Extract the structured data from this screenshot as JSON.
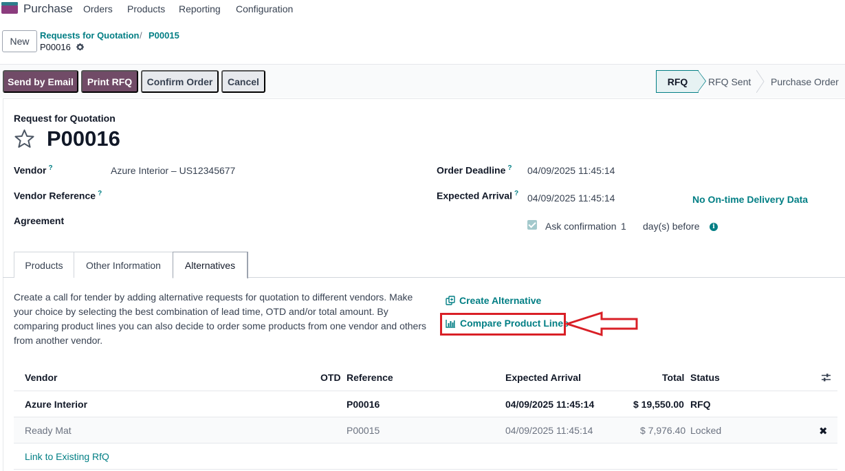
{
  "nav": {
    "app_name": "Purchase",
    "items": [
      "Orders",
      "Products",
      "Reporting",
      "Configuration"
    ]
  },
  "control": {
    "new_label": "New",
    "breadcrumb_parent": "Requests for Quotation",
    "breadcrumb_sep": "/",
    "breadcrumb_prev": "P00015",
    "current": "P00016"
  },
  "actions": {
    "send_email": "Send by Email",
    "print_rfq": "Print RFQ",
    "confirm": "Confirm Order",
    "cancel": "Cancel"
  },
  "statusbar": {
    "steps": [
      "RFQ",
      "RFQ Sent",
      "Purchase Order"
    ],
    "active": "RFQ"
  },
  "form": {
    "doc_type": "Request for Quotation",
    "doc_name": "P00016",
    "vendor_label": "Vendor",
    "vendor_value": "Azure Interior – US12345677",
    "vendor_ref_label": "Vendor Reference",
    "agreement_label": "Agreement",
    "order_deadline_label": "Order Deadline",
    "order_deadline_value": "04/09/2025 11:45:14",
    "expected_arrival_label": "Expected Arrival",
    "expected_arrival_value": "04/09/2025 11:45:14",
    "otd_link": "No On-time Delivery Data",
    "ask_confirmation_label": "Ask confirmation",
    "ask_confirmation_days": "1",
    "days_before": "day(s) before",
    "help_mark": "?"
  },
  "tabs": [
    "Products",
    "Other Information",
    "Alternatives"
  ],
  "alternatives": {
    "description": "Create a call for tender by adding alternative requests for quotation to different vendors. Make your choice by selecting the best combination of lead time, OTD and/or total amount. By comparing product lines you can also decide to order some products from one vendor and others from another vendor.",
    "create_alternative": "Create Alternative",
    "compare_lines": "Compare Product Lines",
    "columns": {
      "vendor": "Vendor",
      "otd": "OTD",
      "reference": "Reference",
      "expected_arrival": "Expected Arrival",
      "total": "Total",
      "status": "Status"
    },
    "rows": [
      {
        "vendor": "Azure Interior",
        "reference": "P00016",
        "expected_arrival": "04/09/2025 11:45:14",
        "total": "$ 19,550.00",
        "status": "RFQ"
      },
      {
        "vendor": "Ready Mat",
        "reference": "P00015",
        "expected_arrival": "04/09/2025 11:45:14",
        "total": "$ 7,976.40",
        "status": "Locked"
      }
    ],
    "link_existing": "Link to Existing RfQ"
  },
  "colors": {
    "primary": "#714b67",
    "teal": "#017e84",
    "highlight": "#d91f26"
  }
}
